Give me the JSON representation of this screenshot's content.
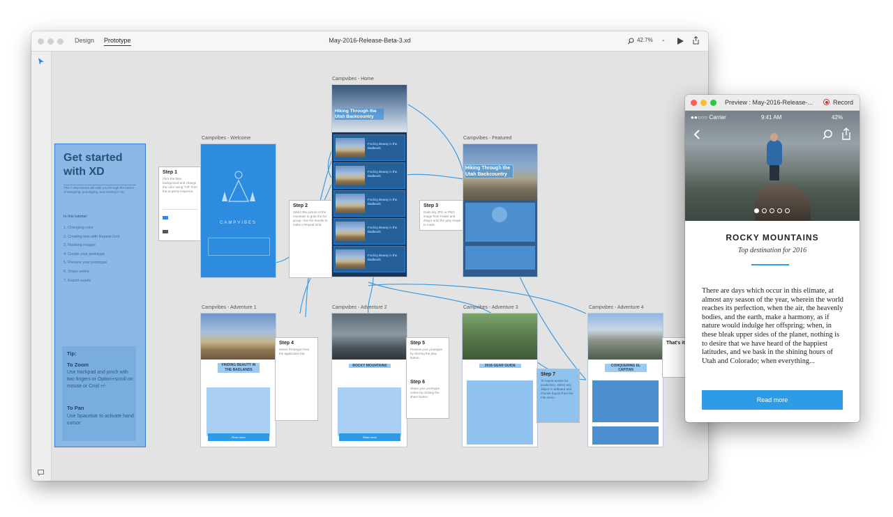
{
  "window": {
    "tabs": [
      "Design",
      "Prototype"
    ],
    "active_tab": "Prototype",
    "title": "May-2016-Release-Beta-3.xd",
    "zoom": "42.7%"
  },
  "canvas": {
    "artboards": {
      "home": "Campvibes - Home",
      "welcome": "Campvibes - Welcome",
      "featured": "Campvibes - Featured",
      "adv1": "Campvibes - Adventure 1",
      "adv2": "Campvibes - Adventure 2",
      "adv3": "Campvibes - Adventure 3",
      "adv4": "Campvibes - Adventure 4"
    },
    "tutorial": {
      "title": "Get started with XD",
      "intro": "This 7 step tutorial will walk you through the basics of designing, prototyping, and sharing in XD.",
      "in_this": "In this tutorial:",
      "items": [
        "1. Changing color",
        "2. Creating lists with Repeat Grid",
        "3. Masking images",
        "4. Create your prototype",
        "5. Preview your prototype",
        "6. Share online",
        "7. Export assets"
      ],
      "tip_heading": "Tip:",
      "zoom_heading": "To Zoom",
      "zoom_text": "Use trackpad and pinch with two fingers or Option+scroll on mouse or Cmd +/-",
      "pan_heading": "To Pan",
      "pan_text": "Use Spacebar to activate hand cursor"
    },
    "steps": {
      "step1": "Step 1",
      "step1_text": "Click the blue background and change the color using \"Fill\" from the property inspector.",
      "step2": "Step 2",
      "step2_text": "Select the picture of the mountain to grab the list group. Use the handle to make a Repeat Grid.",
      "step3": "Step 3",
      "step3_text": "Grab any JPG or PNG image from Finder and drag it onto the gray shape to mask.",
      "step4": "Step 4",
      "step4_text": "Select Prototype from the application bar.",
      "step5": "Step 5",
      "step5_text": "Preview your prototype by clicking the play button.",
      "step6": "Step 6",
      "step6_text": "Share your prototype online by clicking the share button.",
      "step7": "Step 7",
      "step7_text": "To export assets for production, select any object or artboard and choose Export from the File menu.",
      "thats_it": "That's it!"
    },
    "home_card": "Hiking Through the Utah Backcountry",
    "list_item": "Finding Beauty in the Badlands",
    "featured_title": "Hiking Through the Utah Backcountry",
    "adv1_title": "FINDING BEAUTY IN THE BADLANDS",
    "adv2_title": "ROCKY MOUNTAINS",
    "adv3_title": "2016 GEAR GUIDE",
    "adv4_title": "CONQUERING EL CAPITAN",
    "campvibes": "CAMPVIBES",
    "read_more": "Read more"
  },
  "preview": {
    "title": "Preview : May-2016-Release-...",
    "record": "Record",
    "carrier": "Carrier",
    "time": "9:41 AM",
    "battery": "42%",
    "heading": "ROCKY MOUNTAINS",
    "subheading": "Top destination for 2016",
    "body": "There are days which occur in this elimate, at almost any season of the year, wherein the world reaches its perfection, when the air, the heavenly bodies, and the earth, make a harmony, as if nature would indulge her offspring; when, in these bleak upper sides of the planet, nothing is to desire that we have heard of the happiest latitudes, and we bask in the shining hours of Utah and Colorado; when everything...",
    "button": "Read more",
    "accent": "#2e9be6"
  }
}
